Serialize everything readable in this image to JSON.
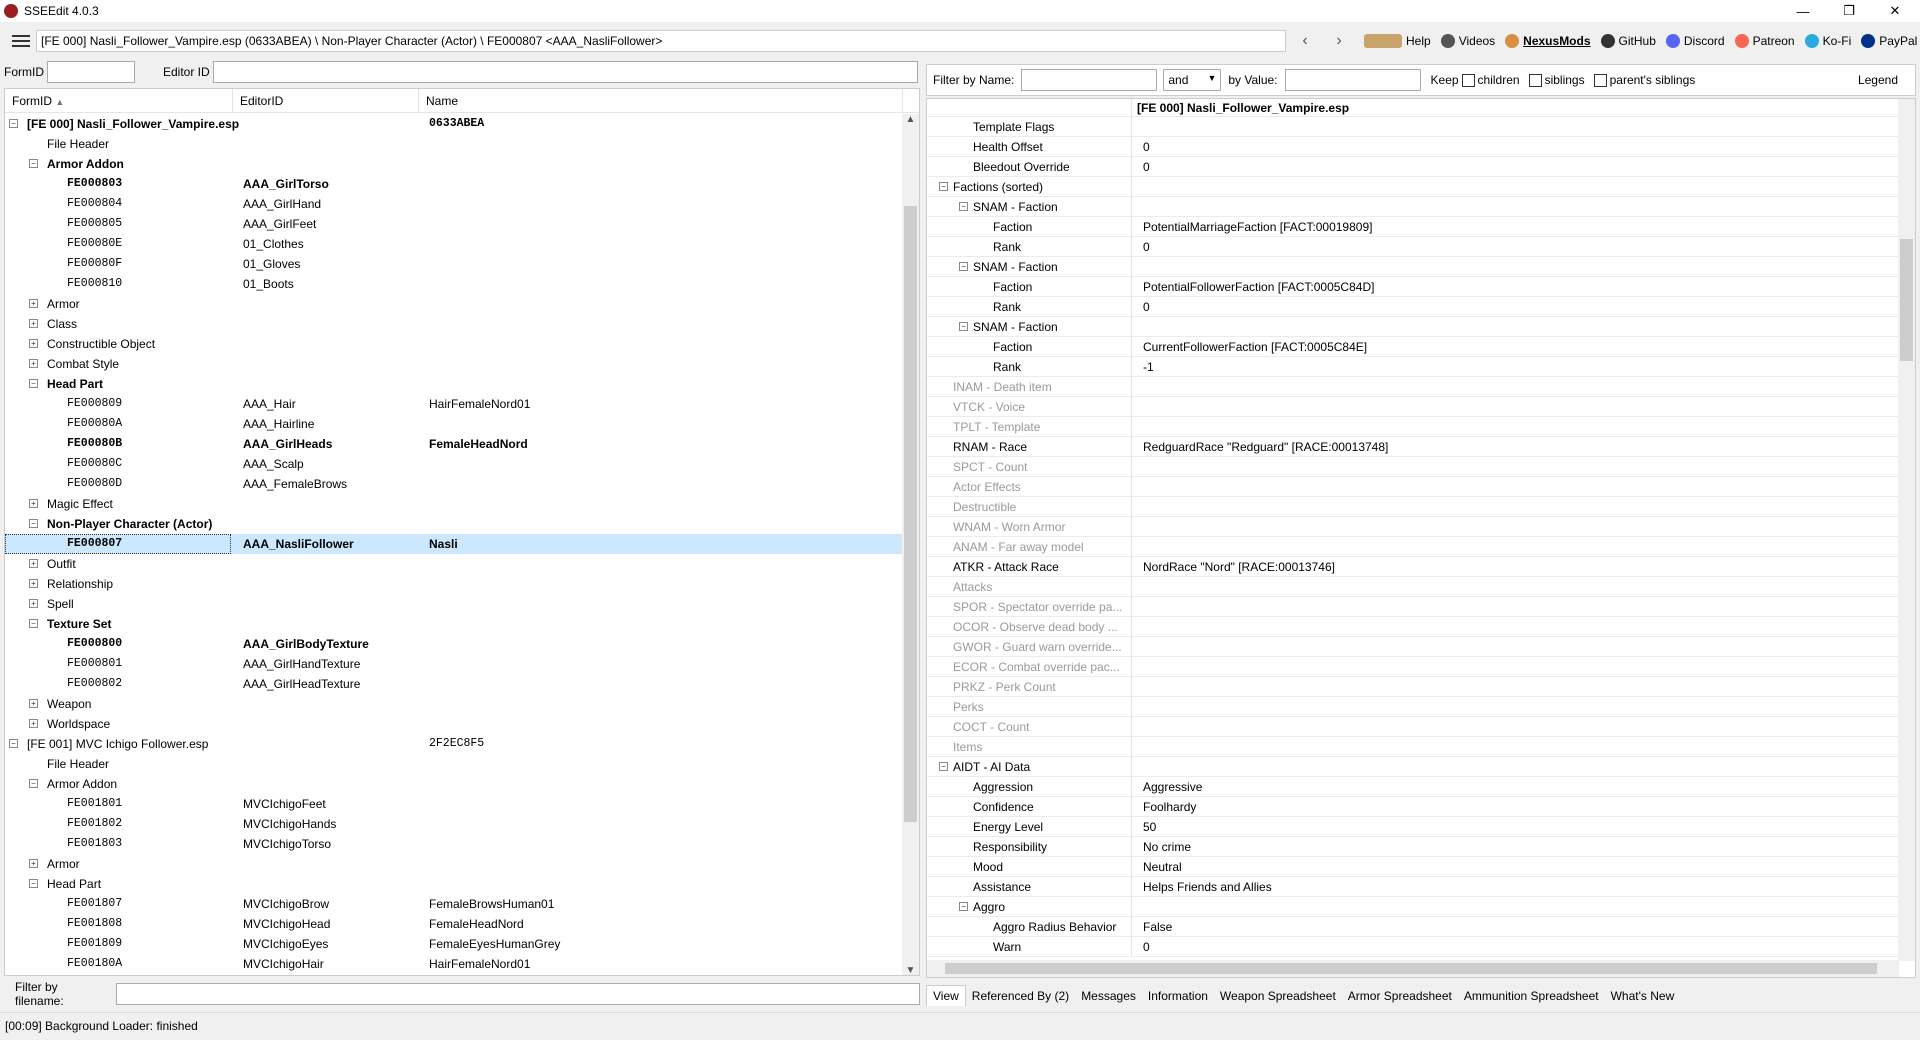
{
  "window": {
    "title": "SSEEdit 4.0.3"
  },
  "toolbar": {
    "path": "[FE 000] Nasli_Follower_Vampire.esp (0633ABEA) \\ Non-Player Character (Actor) \\ FE000807 <AAA_NasliFollower>",
    "links": [
      {
        "label": "Help",
        "icon": "book-icon"
      },
      {
        "label": "Videos",
        "icon": "video-icon"
      },
      {
        "label": "NexusMods",
        "icon": "nexus-icon"
      },
      {
        "label": "GitHub",
        "icon": "github-icon"
      },
      {
        "label": "Discord",
        "icon": "discord-icon"
      },
      {
        "label": "Patreon",
        "icon": "patreon-icon"
      },
      {
        "label": "Ko-Fi",
        "icon": "kofi-icon"
      },
      {
        "label": "PayPal",
        "icon": "paypal-icon"
      }
    ]
  },
  "left_filters": {
    "formid_label": "FormID",
    "editorid_label": "Editor ID"
  },
  "left_columns": [
    "FormID",
    "EditorID",
    "Name"
  ],
  "tree": [
    {
      "level": 0,
      "toggle": "-",
      "formid": "[FE 000] Nasli_Follower_Vampire.esp",
      "editor": "",
      "name": "0633ABEA",
      "bold": true,
      "mono": false
    },
    {
      "level": 1,
      "toggle": "",
      "formid": "File Header",
      "editor": "",
      "name": ""
    },
    {
      "level": 1,
      "toggle": "-",
      "formid": "Armor Addon",
      "editor": "",
      "name": "",
      "bold": true
    },
    {
      "level": 2,
      "toggle": "",
      "formid": "FE000803",
      "editor": "AAA_GirlTorso",
      "name": "",
      "bold": true,
      "mono": true
    },
    {
      "level": 2,
      "toggle": "",
      "formid": "FE000804",
      "editor": "AAA_GirlHand",
      "name": "",
      "mono": true
    },
    {
      "level": 2,
      "toggle": "",
      "formid": "FE000805",
      "editor": "AAA_GirlFeet",
      "name": "",
      "mono": true
    },
    {
      "level": 2,
      "toggle": "",
      "formid": "FE00080E",
      "editor": "01_Clothes",
      "name": "",
      "mono": true
    },
    {
      "level": 2,
      "toggle": "",
      "formid": "FE00080F",
      "editor": "01_Gloves",
      "name": "",
      "mono": true
    },
    {
      "level": 2,
      "toggle": "",
      "formid": "FE000810",
      "editor": "01_Boots",
      "name": "",
      "mono": true
    },
    {
      "level": 1,
      "toggle": "+",
      "formid": "Armor",
      "editor": "",
      "name": ""
    },
    {
      "level": 1,
      "toggle": "+",
      "formid": "Class",
      "editor": "",
      "name": ""
    },
    {
      "level": 1,
      "toggle": "+",
      "formid": "Constructible Object",
      "editor": "",
      "name": ""
    },
    {
      "level": 1,
      "toggle": "+",
      "formid": "Combat Style",
      "editor": "",
      "name": ""
    },
    {
      "level": 1,
      "toggle": "-",
      "formid": "Head Part",
      "editor": "",
      "name": "",
      "bold": true
    },
    {
      "level": 2,
      "toggle": "",
      "formid": "FE000809",
      "editor": "AAA_Hair",
      "name": "HairFemaleNord01",
      "mono": true
    },
    {
      "level": 2,
      "toggle": "",
      "formid": "FE00080A",
      "editor": "AAA_Hairline",
      "name": "",
      "mono": true
    },
    {
      "level": 2,
      "toggle": "",
      "formid": "FE00080B",
      "editor": "AAA_GirlHeads",
      "name": "FemaleHeadNord",
      "bold": true,
      "mono": true
    },
    {
      "level": 2,
      "toggle": "",
      "formid": "FE00080C",
      "editor": "AAA_Scalp",
      "name": "",
      "mono": true
    },
    {
      "level": 2,
      "toggle": "",
      "formid": "FE00080D",
      "editor": "AAA_FemaleBrows",
      "name": "",
      "mono": true
    },
    {
      "level": 1,
      "toggle": "+",
      "formid": "Magic Effect",
      "editor": "",
      "name": ""
    },
    {
      "level": 1,
      "toggle": "-",
      "formid": "Non-Player Character (Actor)",
      "editor": "",
      "name": "",
      "bold": true
    },
    {
      "level": 2,
      "toggle": "",
      "formid": "FE000807",
      "editor": "AAA_NasliFollower",
      "name": "Nasli",
      "bold": true,
      "mono": true,
      "selected": true
    },
    {
      "level": 1,
      "toggle": "+",
      "formid": "Outfit",
      "editor": "",
      "name": ""
    },
    {
      "level": 1,
      "toggle": "+",
      "formid": "Relationship",
      "editor": "",
      "name": ""
    },
    {
      "level": 1,
      "toggle": "+",
      "formid": "Spell",
      "editor": "",
      "name": ""
    },
    {
      "level": 1,
      "toggle": "-",
      "formid": "Texture Set",
      "editor": "",
      "name": "",
      "bold": true
    },
    {
      "level": 2,
      "toggle": "",
      "formid": "FE000800",
      "editor": "AAA_GirlBodyTexture",
      "name": "",
      "bold": true,
      "mono": true
    },
    {
      "level": 2,
      "toggle": "",
      "formid": "FE000801",
      "editor": "AAA_GirlHandTexture",
      "name": "",
      "mono": true
    },
    {
      "level": 2,
      "toggle": "",
      "formid": "FE000802",
      "editor": "AAA_GirlHeadTexture",
      "name": "",
      "mono": true
    },
    {
      "level": 1,
      "toggle": "+",
      "formid": "Weapon",
      "editor": "",
      "name": ""
    },
    {
      "level": 1,
      "toggle": "+",
      "formid": "Worldspace",
      "editor": "",
      "name": ""
    },
    {
      "level": 0,
      "toggle": "-",
      "formid": "[FE 001] MVC Ichigo Follower.esp",
      "editor": "",
      "name": "2F2EC8F5"
    },
    {
      "level": 1,
      "toggle": "",
      "formid": "File Header",
      "editor": "",
      "name": ""
    },
    {
      "level": 1,
      "toggle": "-",
      "formid": "Armor Addon",
      "editor": "",
      "name": ""
    },
    {
      "level": 2,
      "toggle": "",
      "formid": "FE001801",
      "editor": "MVCIchigoFeet",
      "name": "",
      "mono": true
    },
    {
      "level": 2,
      "toggle": "",
      "formid": "FE001802",
      "editor": "MVCIchigoHands",
      "name": "",
      "mono": true
    },
    {
      "level": 2,
      "toggle": "",
      "formid": "FE001803",
      "editor": "MVCIchigoTorso",
      "name": "",
      "mono": true
    },
    {
      "level": 1,
      "toggle": "+",
      "formid": "Armor",
      "editor": "",
      "name": ""
    },
    {
      "level": 1,
      "toggle": "-",
      "formid": "Head Part",
      "editor": "",
      "name": ""
    },
    {
      "level": 2,
      "toggle": "",
      "formid": "FE001807",
      "editor": "MVCIchigoBrow",
      "name": "FemaleBrowsHuman01",
      "mono": true
    },
    {
      "level": 2,
      "toggle": "",
      "formid": "FE001808",
      "editor": "MVCIchigoHead",
      "name": "FemaleHeadNord",
      "mono": true
    },
    {
      "level": 2,
      "toggle": "",
      "formid": "FE001809",
      "editor": "MVCIchigoEyes",
      "name": "FemaleEyesHumanGrey",
      "mono": true
    },
    {
      "level": 2,
      "toggle": "",
      "formid": "FE00180A",
      "editor": "MVCIchigoHair",
      "name": "HairFemaleNord01",
      "mono": true
    }
  ],
  "filter_by_filename": {
    "label": "Filter by filename:"
  },
  "right_filters": {
    "filter_name_label": "Filter by Name:",
    "op_value": "and",
    "by_value_label": "by Value:",
    "keep_label": "Keep",
    "children_label": "children",
    "siblings_label": "siblings",
    "parents_siblings_label": "parent's siblings",
    "legend_label": "Legend"
  },
  "record_header": "[FE 000] Nasli_Follower_Vampire.esp",
  "record_rows": [
    {
      "level": 2,
      "toggle": "",
      "key": "Template Flags",
      "value": ""
    },
    {
      "level": 2,
      "toggle": "",
      "key": "Health Offset",
      "value": "0"
    },
    {
      "level": 2,
      "toggle": "",
      "key": "Bleedout Override",
      "value": "0"
    },
    {
      "level": 1,
      "toggle": "-",
      "key": "Factions (sorted)",
      "value": ""
    },
    {
      "level": 2,
      "toggle": "-",
      "key": "SNAM - Faction",
      "value": ""
    },
    {
      "level": 3,
      "toggle": "",
      "key": "Faction",
      "value": "PotentialMarriageFaction [FACT:00019809]"
    },
    {
      "level": 3,
      "toggle": "",
      "key": "Rank",
      "value": "0"
    },
    {
      "level": 2,
      "toggle": "-",
      "key": "SNAM - Faction",
      "value": ""
    },
    {
      "level": 3,
      "toggle": "",
      "key": "Faction",
      "value": "PotentialFollowerFaction [FACT:0005C84D]"
    },
    {
      "level": 3,
      "toggle": "",
      "key": "Rank",
      "value": "0"
    },
    {
      "level": 2,
      "toggle": "-",
      "key": "SNAM - Faction",
      "value": ""
    },
    {
      "level": 3,
      "toggle": "",
      "key": "Faction",
      "value": "CurrentFollowerFaction [FACT:0005C84E]"
    },
    {
      "level": 3,
      "toggle": "",
      "key": "Rank",
      "value": "-1"
    },
    {
      "level": 1,
      "toggle": "",
      "key": "INAM - Death item",
      "value": "",
      "disabled": true
    },
    {
      "level": 1,
      "toggle": "",
      "key": "VTCK - Voice",
      "value": "",
      "disabled": true
    },
    {
      "level": 1,
      "toggle": "",
      "key": "TPLT - Template",
      "value": "",
      "disabled": true
    },
    {
      "level": 1,
      "toggle": "",
      "key": "RNAM - Race",
      "value": "RedguardRace \"Redguard\" [RACE:00013748]"
    },
    {
      "level": 1,
      "toggle": "",
      "key": "SPCT - Count",
      "value": "",
      "disabled": true
    },
    {
      "level": 1,
      "toggle": "",
      "key": "Actor Effects",
      "value": "",
      "disabled": true
    },
    {
      "level": 1,
      "toggle": "",
      "key": "Destructible",
      "value": "",
      "disabled": true
    },
    {
      "level": 1,
      "toggle": "",
      "key": "WNAM - Worn Armor",
      "value": "",
      "disabled": true
    },
    {
      "level": 1,
      "toggle": "",
      "key": "ANAM - Far away model",
      "value": "",
      "disabled": true
    },
    {
      "level": 1,
      "toggle": "",
      "key": "ATKR - Attack Race",
      "value": "NordRace \"Nord\" [RACE:00013746]"
    },
    {
      "level": 1,
      "toggle": "",
      "key": "Attacks",
      "value": "",
      "disabled": true
    },
    {
      "level": 1,
      "toggle": "",
      "key": "SPOR - Spectator override pa...",
      "value": "",
      "disabled": true
    },
    {
      "level": 1,
      "toggle": "",
      "key": "OCOR - Observe dead body ...",
      "value": "",
      "disabled": true
    },
    {
      "level": 1,
      "toggle": "",
      "key": "GWOR - Guard warn override...",
      "value": "",
      "disabled": true
    },
    {
      "level": 1,
      "toggle": "",
      "key": "ECOR - Combat override pac...",
      "value": "",
      "disabled": true
    },
    {
      "level": 1,
      "toggle": "",
      "key": "PRKZ - Perk Count",
      "value": "",
      "disabled": true
    },
    {
      "level": 1,
      "toggle": "",
      "key": "Perks",
      "value": "",
      "disabled": true
    },
    {
      "level": 1,
      "toggle": "",
      "key": "COCT - Count",
      "value": "",
      "disabled": true
    },
    {
      "level": 1,
      "toggle": "",
      "key": "Items",
      "value": "",
      "disabled": true
    },
    {
      "level": 1,
      "toggle": "-",
      "key": "AIDT - AI Data",
      "value": ""
    },
    {
      "level": 2,
      "toggle": "",
      "key": "Aggression",
      "value": "Aggressive"
    },
    {
      "level": 2,
      "toggle": "",
      "key": "Confidence",
      "value": "Foolhardy"
    },
    {
      "level": 2,
      "toggle": "",
      "key": "Energy Level",
      "value": "50"
    },
    {
      "level": 2,
      "toggle": "",
      "key": "Responsibility",
      "value": "No crime"
    },
    {
      "level": 2,
      "toggle": "",
      "key": "Mood",
      "value": "Neutral"
    },
    {
      "level": 2,
      "toggle": "",
      "key": "Assistance",
      "value": "Helps Friends and Allies"
    },
    {
      "level": 2,
      "toggle": "-",
      "key": "Aggro",
      "value": ""
    },
    {
      "level": 3,
      "toggle": "",
      "key": "Aggro Radius Behavior",
      "value": "False"
    },
    {
      "level": 3,
      "toggle": "",
      "key": "Warn",
      "value": "0"
    }
  ],
  "tabs": [
    "View",
    "Referenced By (2)",
    "Messages",
    "Information",
    "Weapon Spreadsheet",
    "Armor Spreadsheet",
    "Ammunition Spreadsheet",
    "What's New"
  ],
  "status": "[00:09] Background Loader: finished"
}
